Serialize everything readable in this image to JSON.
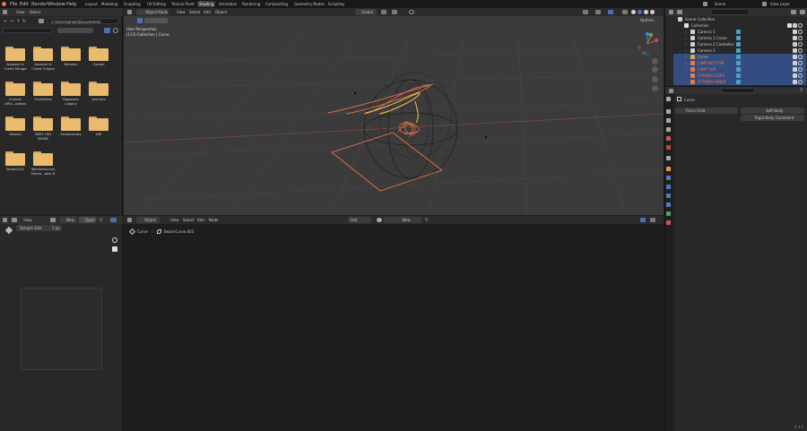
{
  "topmenu": {
    "items": [
      "File",
      "Edit",
      "Render",
      "Window",
      "Help"
    ],
    "workspaces": [
      "Layout",
      "Modeling",
      "Sculpting",
      "UV Editing",
      "Texture Paint",
      "Shading",
      "Animation",
      "Rendering",
      "Compositing",
      "Geometry Nodes",
      "Scripting"
    ],
    "active_workspace": "Shading",
    "scene": "Scene",
    "view_layer": "View Layer"
  },
  "file_browser": {
    "menu": [
      "View",
      "Select"
    ],
    "path": "C:\\Users\\whats\\Documents\\",
    "folders": [
      {
        "label1": "Assassin's",
        "label2": "Creed Mirage"
      },
      {
        "label1": "Assassin's",
        "label2": "Creed Origins"
      },
      {
        "label1": "Blender",
        "label2": ""
      },
      {
        "label1": "Claude",
        "label2": ""
      },
      {
        "label1": "Custom",
        "label2": "Offic...plates"
      },
      {
        "label1": "Overblivia",
        "label2": ""
      },
      {
        "label1": "Hogwarts",
        "label2": "Legacy"
      },
      {
        "label1": "Journals",
        "label2": ""
      },
      {
        "label1": "Movies",
        "label2": ""
      },
      {
        "label1": "NMIT UNI",
        "label2": "WORK"
      },
      {
        "label1": "Screenshots",
        "label2": ""
      },
      {
        "label1": "UNI",
        "label2": ""
      },
      {
        "label1": "Wizard101",
        "label2": ""
      },
      {
        "label1": "Wonderstruck",
        "label2": "Demo...ator 8"
      }
    ]
  },
  "viewport": {
    "mode": "Object Mode",
    "menu": [
      "View",
      "Select",
      "Add",
      "Object"
    ],
    "transform": "Global",
    "options": "Options",
    "info_line1": "User Perspective",
    "info_line2": "(113) Collection | Curve"
  },
  "image_editor": {
    "menu": [
      "View"
    ],
    "new_label": "New",
    "open_label": "Open",
    "sample_label": "Sample Size",
    "sample_value": "1 px"
  },
  "node_editor": {
    "mode": "Object",
    "menu": [
      "View",
      "Select",
      "Add",
      "Node"
    ],
    "slot": "Slot",
    "new_label": "New",
    "breadcrumb_object": "Curve",
    "breadcrumb_data": "BezierCurve.003"
  },
  "outliner": {
    "root": "Scene Collection",
    "collection": "Collection",
    "items": [
      {
        "name": "Camera 1",
        "selected": false,
        "color": "#cfcfcf"
      },
      {
        "name": "Camera 1 Crane",
        "selected": false,
        "color": "#cfcfcf"
      },
      {
        "name": "Camera 2 Controller",
        "selected": false,
        "color": "#cfcfcf"
      },
      {
        "name": "Camera 3",
        "selected": false,
        "color": "#cfcfcf"
      },
      {
        "name": "Curve",
        "selected": true,
        "color": "#f0a04a"
      },
      {
        "name": "LAMP BOTTOM",
        "selected": true,
        "color": "#e8774a"
      },
      {
        "name": "LAMP TOP",
        "selected": true,
        "color": "#e8774a"
      },
      {
        "name": "STRINGS CORE",
        "selected": true,
        "color": "#e8774a"
      },
      {
        "name": "STRINGS INNER",
        "selected": true,
        "color": "#e8774a"
      }
    ]
  },
  "properties": {
    "object_name": "Curve",
    "btn_force_field": "Force Field",
    "btn_soft_body": "Soft Body",
    "btn_rigid_body_constraint": "Rigid Body Constraint"
  },
  "status": {
    "version": "4.1.1"
  },
  "colors": {
    "accent": "#4772b3",
    "selected_orange": "#e8774a",
    "folder": "#e9bb6f"
  }
}
